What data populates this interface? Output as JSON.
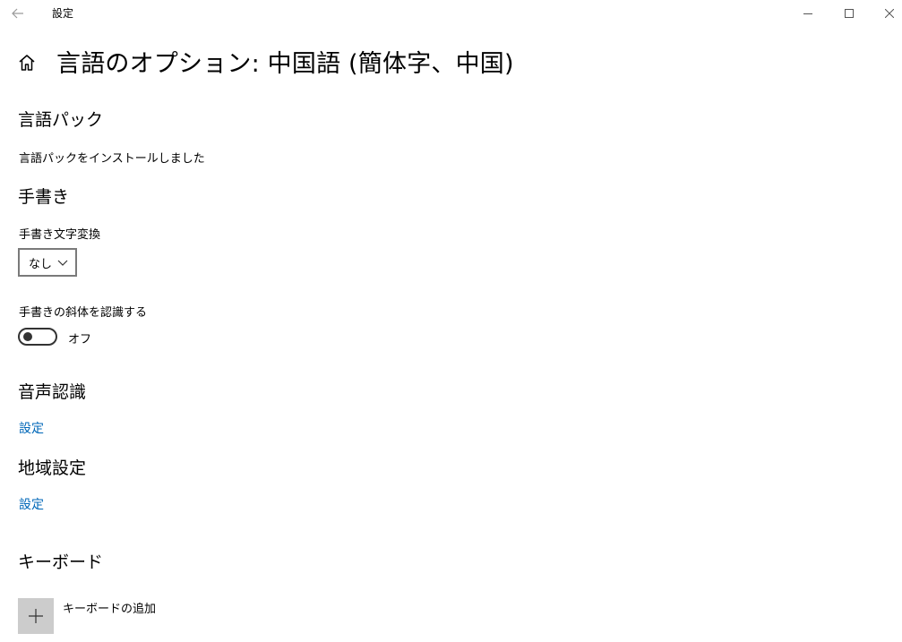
{
  "titlebar": {
    "app_title": "設定"
  },
  "page": {
    "title": "言語のオプション: 中国語 (簡体字、中国)"
  },
  "language_pack": {
    "heading": "言語パック",
    "status": "言語パックをインストールしました"
  },
  "handwriting": {
    "heading": "手書き",
    "conversion_label": "手書き文字変換",
    "conversion_value": "なし",
    "italic_label": "手書きの斜体を認識する",
    "italic_toggle_state": "オフ"
  },
  "speech": {
    "heading": "音声認識",
    "settings_link": "設定"
  },
  "region": {
    "heading": "地域設定",
    "settings_link": "設定"
  },
  "keyboards": {
    "heading": "キーボード",
    "add_label": "キーボードの追加"
  },
  "colors": {
    "link": "#0067b8",
    "add_tile_bg": "#cccccc"
  },
  "icons": {
    "back": "arrow-left",
    "minimize": "minus",
    "maximize": "square",
    "close": "x",
    "home": "house",
    "dropdown": "chevron-down",
    "add": "plus"
  }
}
